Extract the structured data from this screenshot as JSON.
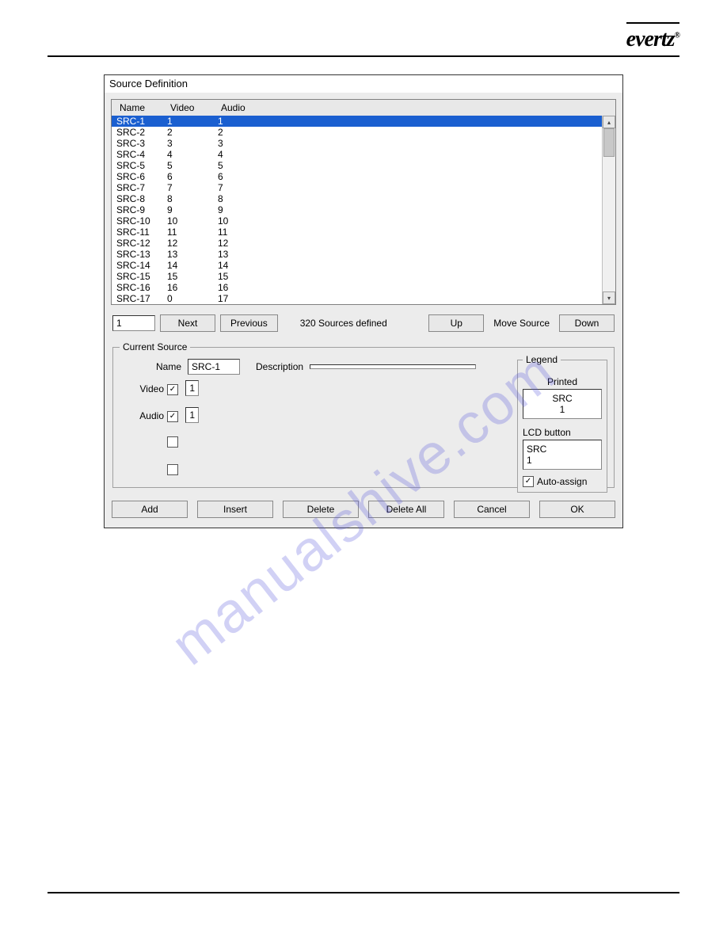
{
  "brand": {
    "name": "evertz",
    "reg": "®"
  },
  "watermark": "manualshive.com",
  "window": {
    "title": "Source Definition",
    "columns": {
      "name": "Name",
      "video": "Video",
      "audio": "Audio"
    },
    "rows": [
      {
        "name": "SRC-1",
        "video": "1",
        "audio": "1",
        "selected": true
      },
      {
        "name": "SRC-2",
        "video": "2",
        "audio": "2",
        "selected": false
      },
      {
        "name": "SRC-3",
        "video": "3",
        "audio": "3",
        "selected": false
      },
      {
        "name": "SRC-4",
        "video": "4",
        "audio": "4",
        "selected": false
      },
      {
        "name": "SRC-5",
        "video": "5",
        "audio": "5",
        "selected": false
      },
      {
        "name": "SRC-6",
        "video": "6",
        "audio": "6",
        "selected": false
      },
      {
        "name": "SRC-7",
        "video": "7",
        "audio": "7",
        "selected": false
      },
      {
        "name": "SRC-8",
        "video": "8",
        "audio": "8",
        "selected": false
      },
      {
        "name": "SRC-9",
        "video": "9",
        "audio": "9",
        "selected": false
      },
      {
        "name": "SRC-10",
        "video": "10",
        "audio": "10",
        "selected": false
      },
      {
        "name": "SRC-11",
        "video": "11",
        "audio": "11",
        "selected": false
      },
      {
        "name": "SRC-12",
        "video": "12",
        "audio": "12",
        "selected": false
      },
      {
        "name": "SRC-13",
        "video": "13",
        "audio": "13",
        "selected": false
      },
      {
        "name": "SRC-14",
        "video": "14",
        "audio": "14",
        "selected": false
      },
      {
        "name": "SRC-15",
        "video": "15",
        "audio": "15",
        "selected": false
      },
      {
        "name": "SRC-16",
        "video": "16",
        "audio": "16",
        "selected": false
      },
      {
        "name": "SRC-17",
        "video": "0",
        "audio": "17",
        "selected": false
      }
    ],
    "nav": {
      "index_value": "1",
      "next": "Next",
      "previous": "Previous",
      "status": "320  Sources defined",
      "up": "Up",
      "move_source": "Move Source",
      "down": "Down"
    },
    "current": {
      "group_title": "Current Source",
      "name_label": "Name",
      "name_value": "SRC-1",
      "description_label": "Description",
      "description_value": "",
      "video_label": "Video",
      "video_checked": "✓",
      "video_value": "1",
      "audio_label": "Audio",
      "audio_checked": "✓",
      "audio_value": "1"
    },
    "legend": {
      "group_title": "Legend",
      "printed_label": "Printed",
      "printed_value": "SRC\n1",
      "lcd_label": "LCD button",
      "lcd_value": "SRC\n1",
      "auto_assign_label": "Auto-assign",
      "auto_assign_checked": "✓"
    },
    "buttons": {
      "add": "Add",
      "insert": "Insert",
      "delete": "Delete",
      "delete_all": "Delete All",
      "cancel": "Cancel",
      "ok": "OK"
    }
  }
}
